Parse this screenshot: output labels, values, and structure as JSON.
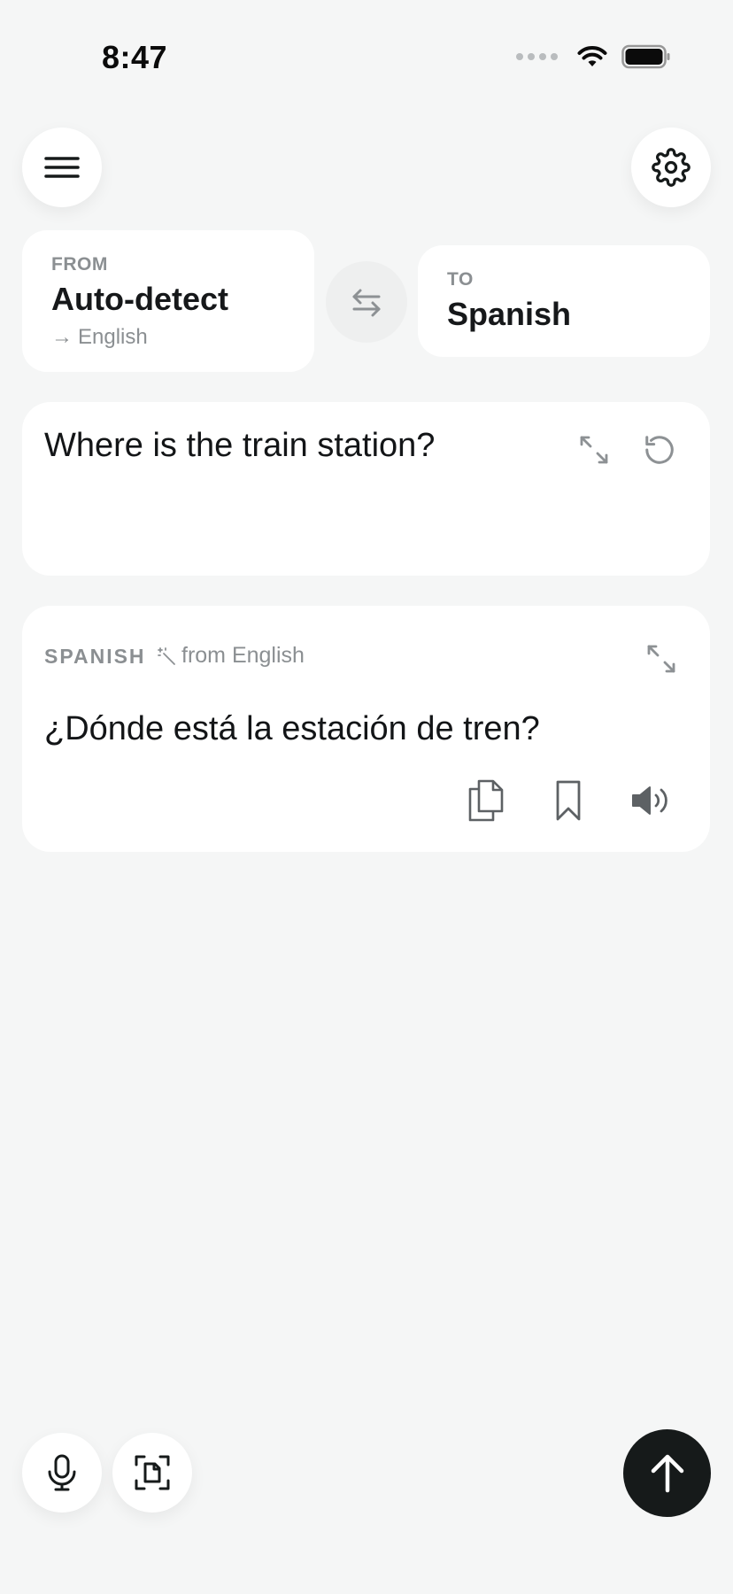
{
  "status_bar": {
    "time": "8:47"
  },
  "language_selector": {
    "from_label": "FROM",
    "from_value": "Auto-detect",
    "detected_arrow": "→",
    "detected_language": "English",
    "to_label": "TO",
    "to_value": "Spanish"
  },
  "input": {
    "text": "Where is the train station?"
  },
  "output": {
    "language_label": "SPANISH",
    "source_note": "from English",
    "text": "¿Dónde está la estación de tren?"
  },
  "icons": {
    "menu": "menu-icon",
    "settings": "gear-icon",
    "swap": "swap-arrows-icon",
    "expand": "expand-icon",
    "reset": "rotate-ccw-icon",
    "copy": "copy-icon",
    "bookmark": "bookmark-icon",
    "speaker": "speaker-icon",
    "mic": "microphone-icon",
    "scan": "scan-document-icon",
    "send": "arrow-up-icon",
    "magic": "magic-wand-icon"
  },
  "colors": {
    "background": "#f5f6f6",
    "card": "#ffffff",
    "muted_text": "#8b8f92",
    "send_button": "#161a1a"
  }
}
